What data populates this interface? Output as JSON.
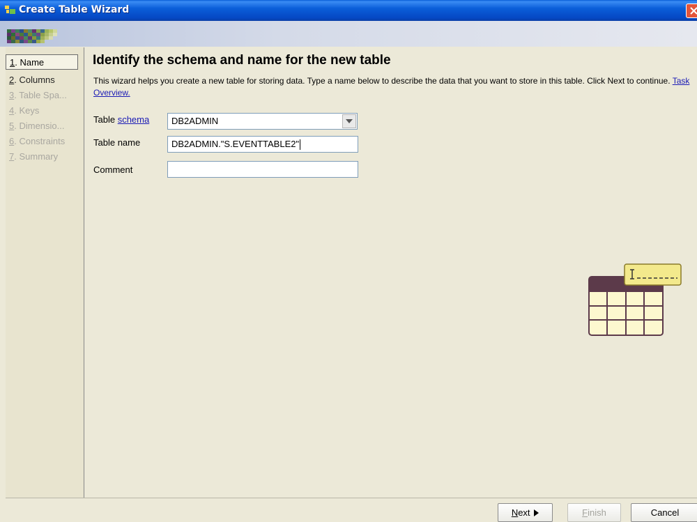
{
  "window": {
    "title": "Create Table Wizard"
  },
  "steps": [
    {
      "num": "1",
      "label": ". Name",
      "state": "active"
    },
    {
      "num": "2",
      "label": ". Columns",
      "state": "enabled"
    },
    {
      "num": "3",
      "label": ". Table Spa...",
      "state": "disabled"
    },
    {
      "num": "4",
      "label": ". Keys",
      "state": "disabled"
    },
    {
      "num": "5",
      "label": ". Dimensio...",
      "state": "disabled"
    },
    {
      "num": "6",
      "label": ". Constraints",
      "state": "disabled"
    },
    {
      "num": "7",
      "label": ". Summary",
      "state": "disabled"
    }
  ],
  "main": {
    "heading": "Identify the schema and name for the new table",
    "description": "This wizard helps you create a new table for storing data. Type a name below to describe the data that you want to store in this table. Click Next to continue.",
    "task_link": "Task Overview."
  },
  "form": {
    "schema_label_prefix": "Table ",
    "schema_link": "schema",
    "schema_value": "DB2ADMIN",
    "name_label": "Table name",
    "name_value": "DB2ADMIN.\"S.EVENTTABLE2\"",
    "comment_label": "Comment",
    "comment_value": ""
  },
  "buttons": {
    "next_mnemonic": "N",
    "next_rest": "ext",
    "finish_mnemonic": "F",
    "finish_rest": "inish",
    "cancel": "Cancel"
  },
  "colors": {
    "titlebar": "#0b5ed9",
    "link": "#1a1ab5",
    "table_header": "#5c3a4a",
    "table_cell": "#fdf8cf",
    "tag": "#f3e98c"
  },
  "icons": [
    "app-icon",
    "close-icon",
    "dropdown-arrow-icon",
    "new-table-illustration",
    "next-arrow-icon"
  ]
}
